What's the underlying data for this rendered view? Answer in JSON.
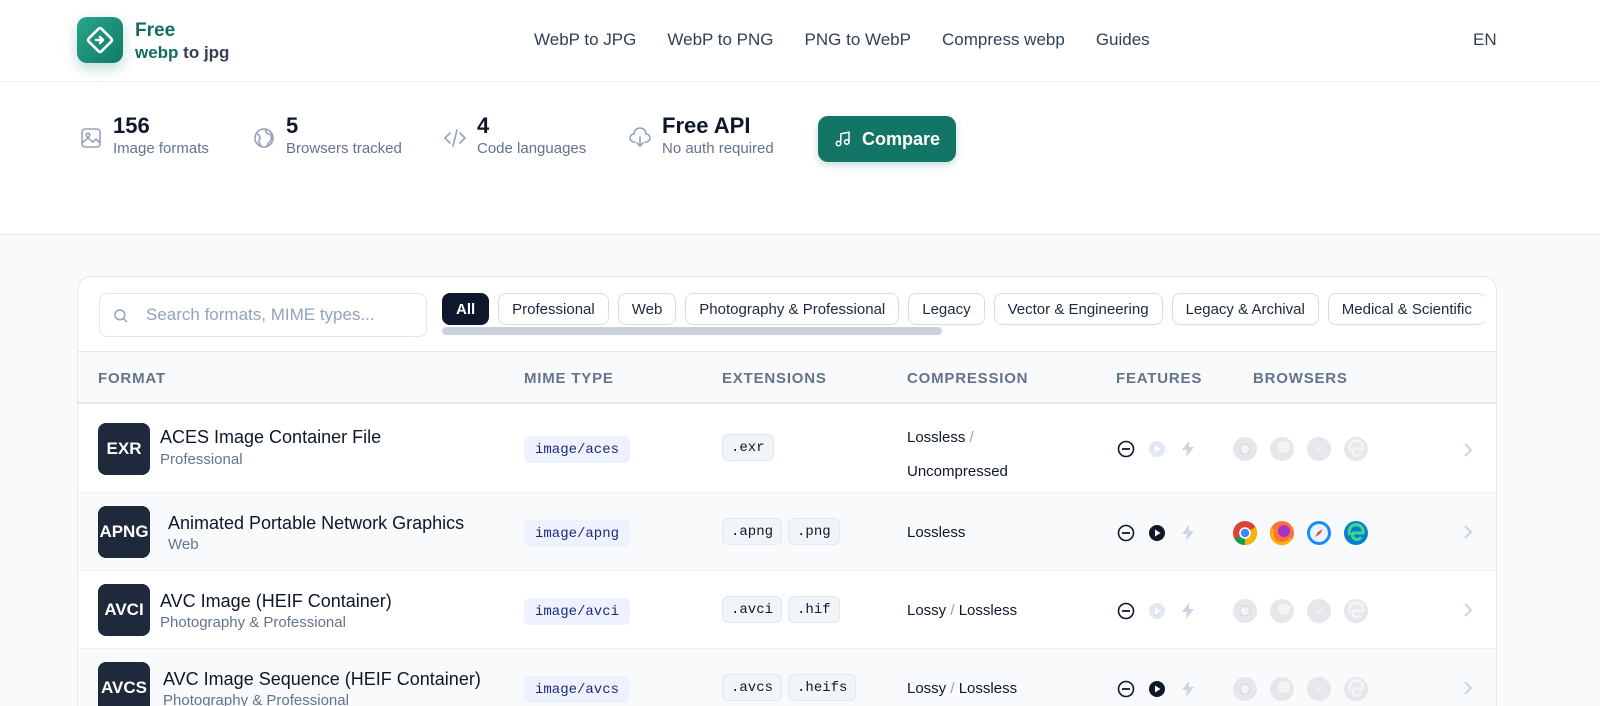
{
  "brand": {
    "line1": "Free",
    "line2_accent": "webp",
    "line2_rest": " to jpg"
  },
  "nav": [
    "WebP to JPG",
    "WebP to PNG",
    "PNG to WebP",
    "Compress webp",
    "Guides"
  ],
  "lang": "EN",
  "stats": [
    {
      "value": "156",
      "label": "Image formats",
      "icon": "image-icon"
    },
    {
      "value": "5",
      "label": "Browsers tracked",
      "icon": "globe-icon"
    },
    {
      "value": "4",
      "label": "Code languages",
      "icon": "code-icon"
    },
    {
      "value": "Free API",
      "label": "No auth required",
      "icon": "cloud-download-icon"
    }
  ],
  "compare_label": "Compare",
  "search": {
    "placeholder": "Search formats, MIME types..."
  },
  "filters": [
    "All",
    "Professional",
    "Web",
    "Photography & Professional",
    "Legacy",
    "Vector & Engineering",
    "Legacy & Archival",
    "Medical & Scientific"
  ],
  "active_filter": "All",
  "columns": [
    "FORMAT",
    "MIME TYPE",
    "EXTENSIONS",
    "COMPRESSION",
    "FEATURES",
    "BROWSERS"
  ],
  "rows": [
    {
      "badge": "EXR",
      "name": "ACES Image Container File",
      "category": "Professional",
      "mime": "image/aces",
      "extensions": [
        ".exr"
      ],
      "compression": [
        "Lossless",
        "Uncompressed"
      ],
      "animation": false,
      "browsers_supported": false
    },
    {
      "badge": "APNG",
      "name": "Animated Portable Network Graphics",
      "category": "Web",
      "mime": "image/apng",
      "extensions": [
        ".apng",
        ".png"
      ],
      "compression": [
        "Lossless"
      ],
      "animation": true,
      "browsers_supported": true
    },
    {
      "badge": "AVCI",
      "name": "AVC Image (HEIF Container)",
      "category": "Photography & Professional",
      "mime": "image/avci",
      "extensions": [
        ".avci",
        ".hif"
      ],
      "compression": [
        "Lossy",
        "Lossless"
      ],
      "animation": false,
      "browsers_supported": false
    },
    {
      "badge": "AVCS",
      "name": "AVC Image Sequence (HEIF Container)",
      "category": "Photography & Professional",
      "mime": "image/avcs",
      "extensions": [
        ".avcs",
        ".heifs"
      ],
      "compression": [
        "Lossy",
        "Lossless"
      ],
      "animation": true,
      "browsers_supported": false
    }
  ],
  "colors": {
    "brand": "#137565",
    "dark": "#0f172a",
    "muted": "#64748b"
  }
}
